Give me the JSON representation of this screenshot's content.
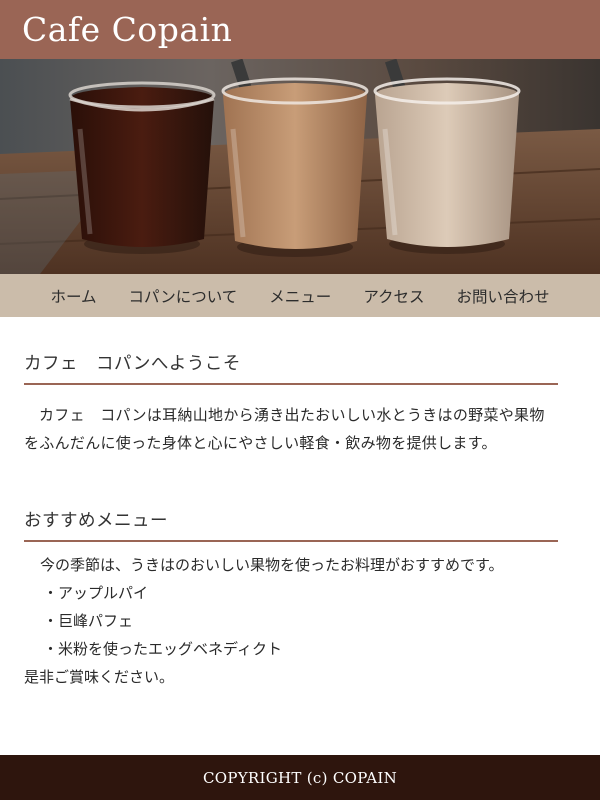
{
  "header": {
    "title": "Cafe Copain"
  },
  "hero": {
    "alt": "three-glasses-of-coffee-photo"
  },
  "nav": {
    "items": [
      {
        "label": "ホーム"
      },
      {
        "label": "コパンについて"
      },
      {
        "label": "メニュー"
      },
      {
        "label": "アクセス"
      },
      {
        "label": "お問い合わせ"
      }
    ]
  },
  "welcome": {
    "heading": "カフェ　コパンへようこそ",
    "body": "カフェ　コパンは耳納山地から湧き出たおいしい水とうきはの野菜や果物をふんだんに使った身体と心にやさしい軽食・飲み物を提供します。"
  },
  "recommend": {
    "heading": "おすすめメニュー",
    "lead": "今の季節は、うきはのおいしい果物を使ったお料理がおすすめです。",
    "items": [
      "・アップルパイ",
      "・巨峰パフェ",
      "・米粉を使ったエッグベネディクト"
    ],
    "outro": "是非ご賞味ください。"
  },
  "footer": {
    "copyright": "COPYRIGHT (c) COPAIN"
  },
  "colors": {
    "header": "#9a6555",
    "nav": "#cbbcaa",
    "footer": "#2e150d",
    "rule": "#9a6555"
  }
}
